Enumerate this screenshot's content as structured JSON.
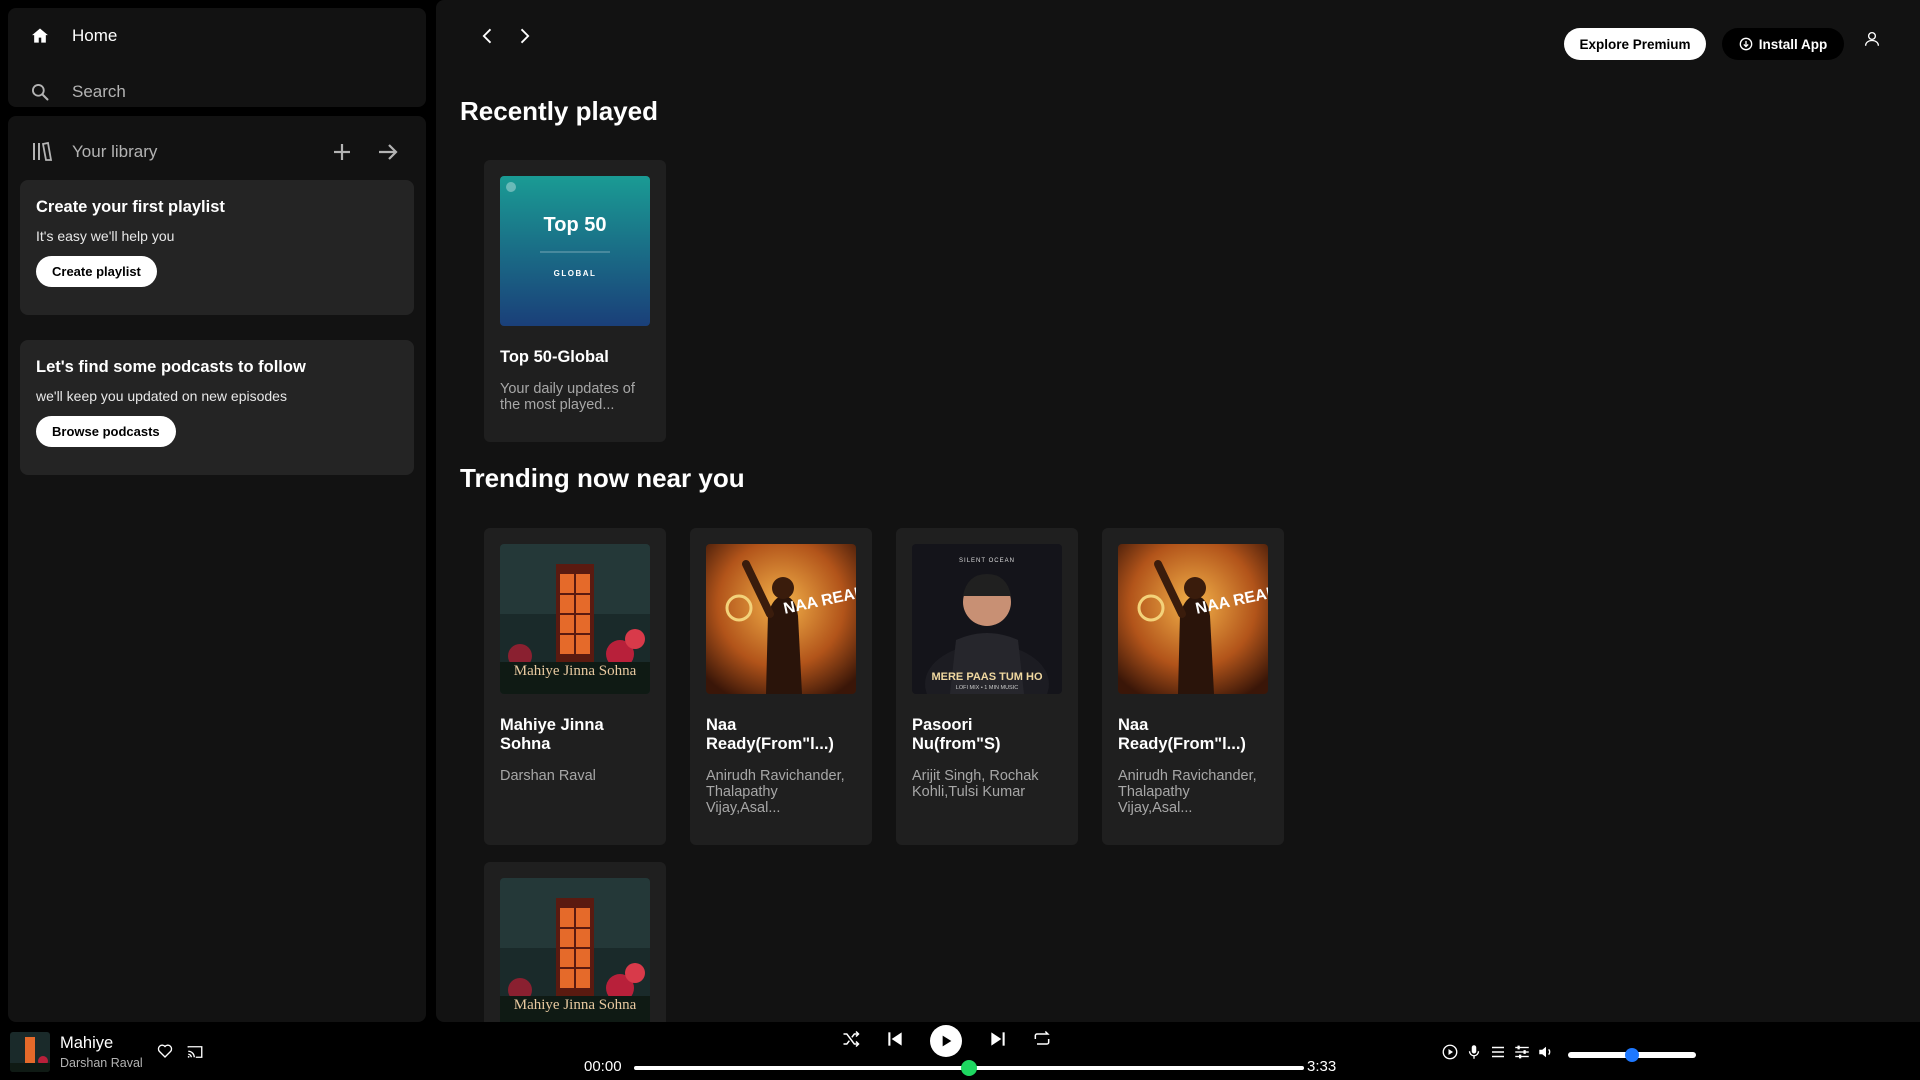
{
  "sidebar": {
    "nav": {
      "home": "Home",
      "search": "Search"
    },
    "library": {
      "title": "Your library"
    },
    "promos": [
      {
        "title": "Create your first playlist",
        "text": "It's easy we'll help you",
        "button": "Create playlist"
      },
      {
        "title": "Let's find some podcasts to follow",
        "text": "we'll keep you updated on new episodes",
        "button": "Browse podcasts"
      }
    ]
  },
  "header": {
    "premium": "Explore Premium",
    "install": "Install App"
  },
  "sections": {
    "recent": {
      "title": "Recently played",
      "cards": [
        {
          "title": "Top 50-Global",
          "sub": "Your daily updates of the most played...",
          "art_text": "Top 50",
          "art_sub": "GLOBAL"
        }
      ]
    },
    "trending": {
      "title": "Trending now near you",
      "cards": [
        {
          "title": "Mahiye Jinna Sohna",
          "sub": "Darshan Raval",
          "art_text": "Mahiye Jinna Sohna"
        },
        {
          "title": "Naa Ready(From\"l...)",
          "sub": "Anirudh Ravichander, Thalapathy Vijay,Asal...",
          "art_text": "NAA READY"
        },
        {
          "title": "Pasoori Nu(from\"S)",
          "sub": "Arijit Singh, Rochak Kohli,Tulsi Kumar",
          "art_text": "MERE PAAS TUM HO",
          "art_sub": "LOFI MIX • 1 MIN MUSIC",
          "art_top": "SILENT OCEAN"
        },
        {
          "title": "Naa Ready(From\"l...)",
          "sub": "Anirudh Ravichander, Thalapathy Vijay,Asal...",
          "art_text": "NAA READY"
        },
        {
          "title": "",
          "sub": "",
          "art_text": "Mahiye Jinna Sohna"
        }
      ]
    }
  },
  "player": {
    "track": "Mahiye",
    "artist": "Darshan Raval",
    "elapsed": "00:00",
    "duration": "3:33",
    "progress": 0.5,
    "volume": 0.5
  },
  "colors": {
    "accent": "#1ed760",
    "volume_knob": "#1e78ff",
    "panel": "#121212",
    "card": "#1f1f1f"
  }
}
